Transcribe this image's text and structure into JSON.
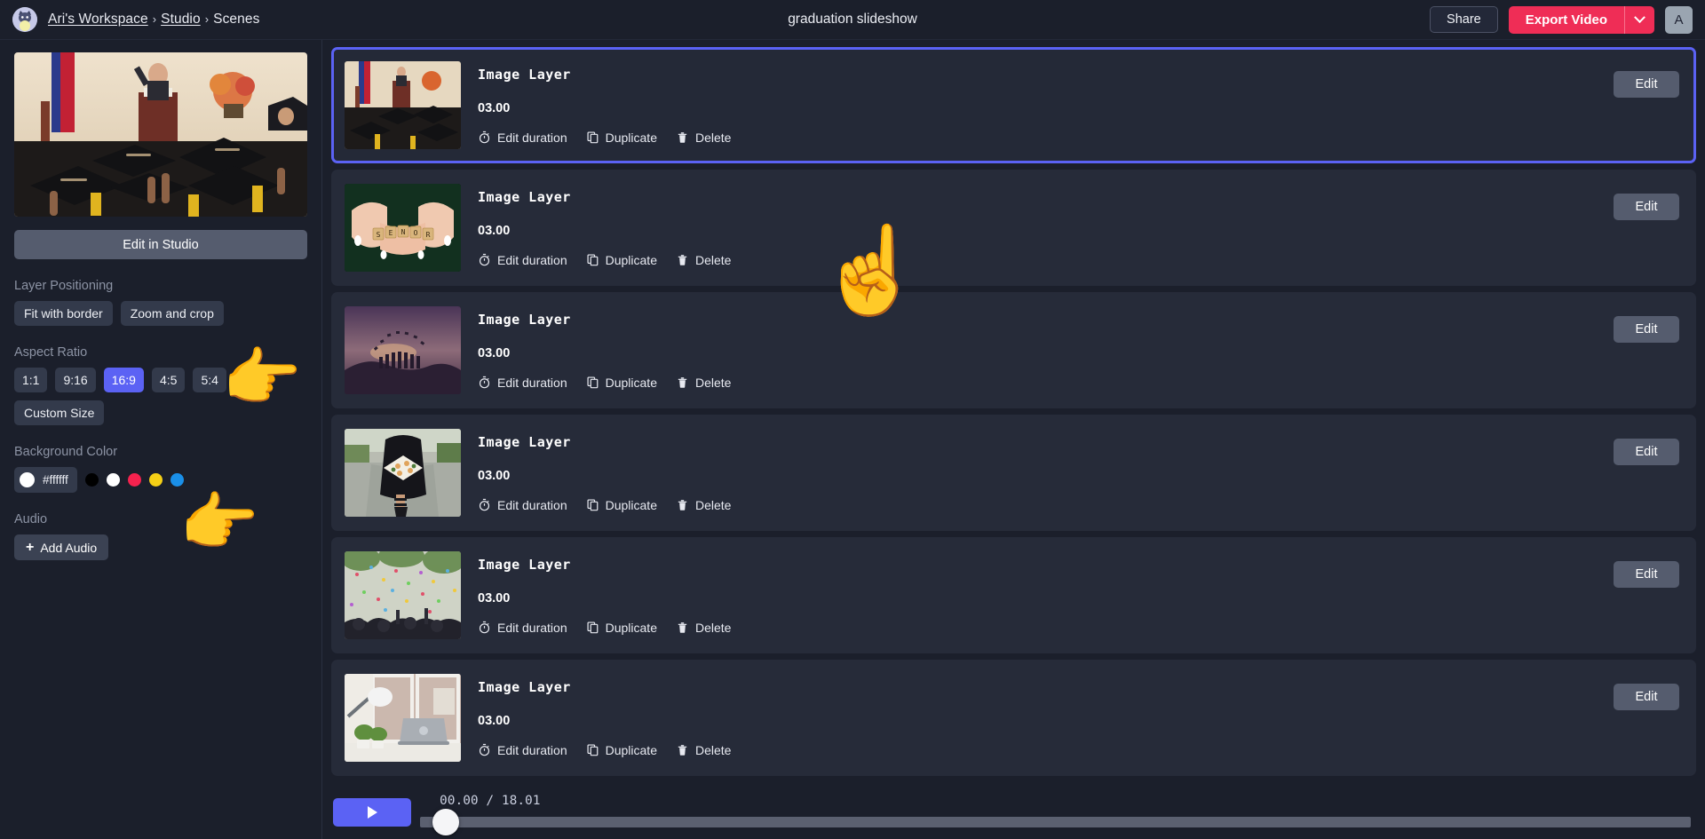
{
  "topbar": {
    "logo_icon": "cat-avatar-icon",
    "breadcrumb": {
      "workspace": "Ari's Workspace",
      "sep1": "›",
      "studio": "Studio",
      "sep2": "›",
      "current": "Scenes"
    },
    "document_title": "graduation slideshow",
    "share_label": "Share",
    "export_label": "Export Video",
    "export_caret_icon": "chevron-down-icon",
    "user_initial": "A",
    "accent_export_color": "#ef2d56"
  },
  "sidebar": {
    "preview_alt": "graduation ceremony preview",
    "edit_in_studio_label": "Edit in Studio",
    "layer_positioning": {
      "label": "Layer Positioning",
      "options": [
        "Fit with border",
        "Zoom and crop"
      ]
    },
    "aspect_ratio": {
      "label": "Aspect Ratio",
      "options": [
        "1:1",
        "9:16",
        "16:9",
        "4:5",
        "5:4",
        "Custom Size"
      ],
      "selected": "16:9",
      "selected_color": "#5b62f4"
    },
    "background_color": {
      "label": "Background Color",
      "value": "#ffffff",
      "swatches": [
        "#000000",
        "#ffffff",
        "#f5224e",
        "#f5cf16",
        "#1a8fe8"
      ]
    },
    "audio": {
      "label": "Audio",
      "add_label": "Add Audio",
      "add_icon": "plus-icon"
    }
  },
  "scenes": {
    "row_actions": {
      "edit_duration": "Edit duration",
      "edit_duration_icon": "stopwatch-icon",
      "duplicate": "Duplicate",
      "duplicate_icon": "copy-icon",
      "delete": "Delete",
      "delete_icon": "trash-icon"
    },
    "edit_label": "Edit",
    "items": [
      {
        "name": "Image Layer",
        "duration": "03.00",
        "thumb": "graduation-ceremony-caps",
        "selected": true
      },
      {
        "name": "Image Layer",
        "duration": "03.00",
        "thumb": "senior-scrabble-tiles",
        "selected": false
      },
      {
        "name": "Image Layer",
        "duration": "03.00",
        "thumb": "sunset-cap-toss-silhouette",
        "selected": false
      },
      {
        "name": "Image Layer",
        "duration": "03.00",
        "thumb": "grad-gown-holding-cap",
        "selected": false
      },
      {
        "name": "Image Layer",
        "duration": "03.00",
        "thumb": "confetti-celebration",
        "selected": false
      },
      {
        "name": "Image Layer",
        "duration": "03.00",
        "thumb": "desk-laptop-window",
        "selected": false
      }
    ]
  },
  "playback": {
    "play_icon": "play-icon",
    "current_time": "00.00",
    "separator": "/",
    "total_time": "18.01",
    "progress_percent": 0
  },
  "overlay": {
    "hand_scene": "☝️",
    "hand_positioning": "👉",
    "hand_bgcolor": "👉"
  }
}
